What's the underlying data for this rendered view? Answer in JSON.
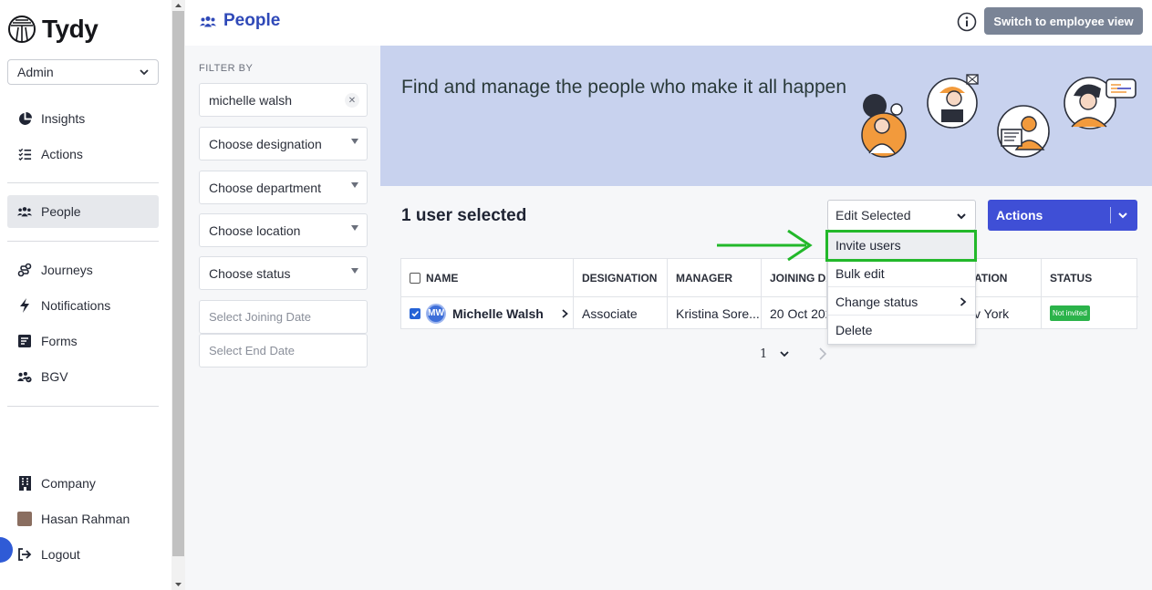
{
  "app": {
    "logo_text": "Tydy",
    "role": "Admin"
  },
  "sidebar": {
    "items": [
      {
        "label": "Insights",
        "icon": "pie-chart-icon"
      },
      {
        "label": "Actions",
        "icon": "checklist-icon"
      },
      {
        "label": "People",
        "icon": "people-icon",
        "active": true
      },
      {
        "label": "Journeys",
        "icon": "route-icon"
      },
      {
        "label": "Notifications",
        "icon": "bolt-icon"
      },
      {
        "label": "Forms",
        "icon": "form-icon"
      },
      {
        "label": "BGV",
        "icon": "verify-group-icon"
      }
    ],
    "bottom": [
      {
        "label": "Company",
        "icon": "building-icon"
      },
      {
        "label": "Hasan Rahman",
        "icon": "user-avatar"
      },
      {
        "label": "Logout",
        "icon": "logout-icon"
      }
    ]
  },
  "header": {
    "title": "People",
    "switch_button": "Switch to employee view"
  },
  "filters": {
    "label": "FILTER BY",
    "search_value": "michelle walsh",
    "designation": "Choose designation",
    "department": "Choose department",
    "location": "Choose location",
    "status": "Choose status",
    "joining_date": "Select Joining Date",
    "end_date": "Select End Date"
  },
  "banner": {
    "text": "Find and manage the people who make it all happen"
  },
  "selection": {
    "title": "1 user selected",
    "edit_select": "Edit Selected",
    "actions_label": "Actions"
  },
  "table": {
    "headers": [
      "NAME",
      "DESIGNATION",
      "MANAGER",
      "JOINING DA",
      "ATION",
      "STATUS"
    ],
    "row": {
      "initials": "MW",
      "name": "Michelle Walsh",
      "designation": "Associate",
      "manager": "Kristina Sore...",
      "joining": "20 Oct 202",
      "location": "v York",
      "status": "Not invited"
    }
  },
  "pagination": {
    "page": "1"
  },
  "menu": {
    "items": [
      "Invite users",
      "Bulk edit",
      "Change status",
      "Delete"
    ]
  },
  "colors": {
    "accent": "#3f4fd6",
    "title_blue": "#2f49b8",
    "banner": "#c8d2ee",
    "highlight_green": "#22b82a",
    "status_green": "#2bb34a"
  }
}
